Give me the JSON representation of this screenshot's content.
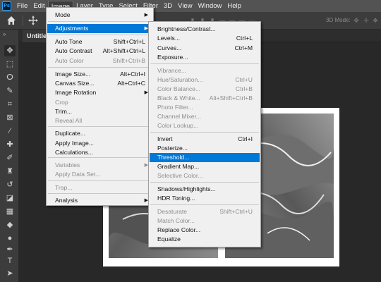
{
  "menubar": {
    "logo": "Ps",
    "items": [
      "File",
      "Edit",
      "Image",
      "Layer",
      "Type",
      "Select",
      "Filter",
      "3D",
      "View",
      "Window",
      "Help"
    ]
  },
  "options": {
    "threed_label": "3D Mode:"
  },
  "document": {
    "tab_title": "Untitled"
  },
  "image_menu": {
    "items": [
      {
        "label": "Mode",
        "shortcut": "",
        "submenu": true,
        "disabled": false
      },
      {
        "label": "Adjustments",
        "shortcut": "",
        "submenu": true,
        "disabled": false,
        "highlighted": true
      },
      {
        "label": "Auto Tone",
        "shortcut": "Shift+Ctrl+L",
        "disabled": false
      },
      {
        "label": "Auto Contrast",
        "shortcut": "Alt+Shift+Ctrl+L",
        "disabled": false
      },
      {
        "label": "Auto Color",
        "shortcut": "Shift+Ctrl+B",
        "disabled": true
      },
      {
        "label": "Image Size...",
        "shortcut": "Alt+Ctrl+I",
        "disabled": false
      },
      {
        "label": "Canvas Size...",
        "shortcut": "Alt+Ctrl+C",
        "disabled": false
      },
      {
        "label": "Image Rotation",
        "shortcut": "",
        "submenu": true,
        "disabled": false
      },
      {
        "label": "Crop",
        "shortcut": "",
        "disabled": true
      },
      {
        "label": "Trim...",
        "shortcut": "",
        "disabled": false
      },
      {
        "label": "Reveal All",
        "shortcut": "",
        "disabled": true
      },
      {
        "label": "Duplicate...",
        "shortcut": "",
        "disabled": false
      },
      {
        "label": "Apply Image...",
        "shortcut": "",
        "disabled": false
      },
      {
        "label": "Calculations...",
        "shortcut": "",
        "disabled": false
      },
      {
        "label": "Variables",
        "shortcut": "",
        "submenu": true,
        "disabled": true
      },
      {
        "label": "Apply Data Set...",
        "shortcut": "",
        "disabled": true
      },
      {
        "label": "Trap...",
        "shortcut": "",
        "disabled": true
      },
      {
        "label": "Analysis",
        "shortcut": "",
        "submenu": true,
        "disabled": false
      }
    ]
  },
  "adjustments_menu": {
    "items": [
      {
        "label": "Brightness/Contrast...",
        "shortcut": "",
        "disabled": false
      },
      {
        "label": "Levels...",
        "shortcut": "Ctrl+L",
        "disabled": false
      },
      {
        "label": "Curves...",
        "shortcut": "Ctrl+M",
        "disabled": false
      },
      {
        "label": "Exposure...",
        "shortcut": "",
        "disabled": false
      },
      {
        "label": "Vibrance...",
        "shortcut": "",
        "disabled": true
      },
      {
        "label": "Hue/Saturation...",
        "shortcut": "Ctrl+U",
        "disabled": true
      },
      {
        "label": "Color Balance...",
        "shortcut": "Ctrl+B",
        "disabled": true
      },
      {
        "label": "Black & White...",
        "shortcut": "Alt+Shift+Ctrl+B",
        "disabled": true
      },
      {
        "label": "Photo Filter...",
        "shortcut": "",
        "disabled": true
      },
      {
        "label": "Channel Mixer...",
        "shortcut": "",
        "disabled": true
      },
      {
        "label": "Color Lookup...",
        "shortcut": "",
        "disabled": true
      },
      {
        "label": "Invert",
        "shortcut": "Ctrl+I",
        "disabled": false
      },
      {
        "label": "Posterize...",
        "shortcut": "",
        "disabled": false
      },
      {
        "label": "Threshold...",
        "shortcut": "",
        "disabled": false,
        "highlighted": true
      },
      {
        "label": "Gradient Map...",
        "shortcut": "",
        "disabled": false
      },
      {
        "label": "Selective Color...",
        "shortcut": "",
        "disabled": true
      },
      {
        "label": "Shadows/Highlights...",
        "shortcut": "",
        "disabled": false
      },
      {
        "label": "HDR Toning...",
        "shortcut": "",
        "disabled": false
      },
      {
        "label": "Desaturate",
        "shortcut": "Shift+Ctrl+U",
        "disabled": true
      },
      {
        "label": "Match Color...",
        "shortcut": "",
        "disabled": true
      },
      {
        "label": "Replace Color...",
        "shortcut": "",
        "disabled": false
      },
      {
        "label": "Equalize",
        "shortcut": "",
        "disabled": false
      }
    ]
  },
  "colors": {
    "menu_highlight": "#0078d7",
    "menubar_bg": "#535353",
    "canvas_bg": "#282828",
    "toolbar_bg": "#3c3c3c"
  }
}
